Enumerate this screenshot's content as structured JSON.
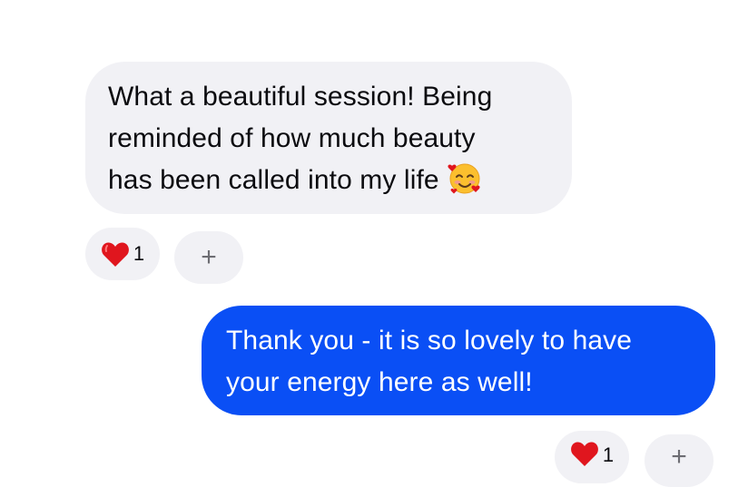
{
  "messages": {
    "incoming": {
      "lines": [
        "What a beautiful session! Being",
        "reminded of how much beauty",
        "has been called into my life"
      ],
      "emoji": "smiling-face-with-hearts",
      "reaction": {
        "emoji": "heart",
        "count": "1"
      },
      "add_reaction_label": "+"
    },
    "outgoing": {
      "lines": [
        "Thank you - it is so lovely to have",
        "your energy here as well!"
      ],
      "reaction": {
        "emoji": "heart",
        "count": "1"
      },
      "add_reaction_label": "+"
    }
  },
  "colors": {
    "incoming_bubble": "#f1f1f5",
    "outgoing_bubble": "#0a4ff5",
    "heart": "#e0161e"
  }
}
